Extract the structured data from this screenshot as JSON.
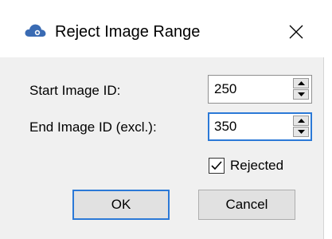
{
  "dialog": {
    "title": "Reject Image Range",
    "app_icon": "cloud-icon",
    "close_icon": "close-icon"
  },
  "fields": {
    "start": {
      "label": "Start Image ID:",
      "value": "250"
    },
    "end": {
      "label": "End Image ID (excl.):",
      "value": "350"
    }
  },
  "rejected": {
    "label": "Rejected",
    "checked": true
  },
  "buttons": {
    "ok": "OK",
    "cancel": "Cancel"
  },
  "colors": {
    "accent": "#2b79d7",
    "icon_blue": "#3a6bb3",
    "background": "#f0f0f0"
  }
}
